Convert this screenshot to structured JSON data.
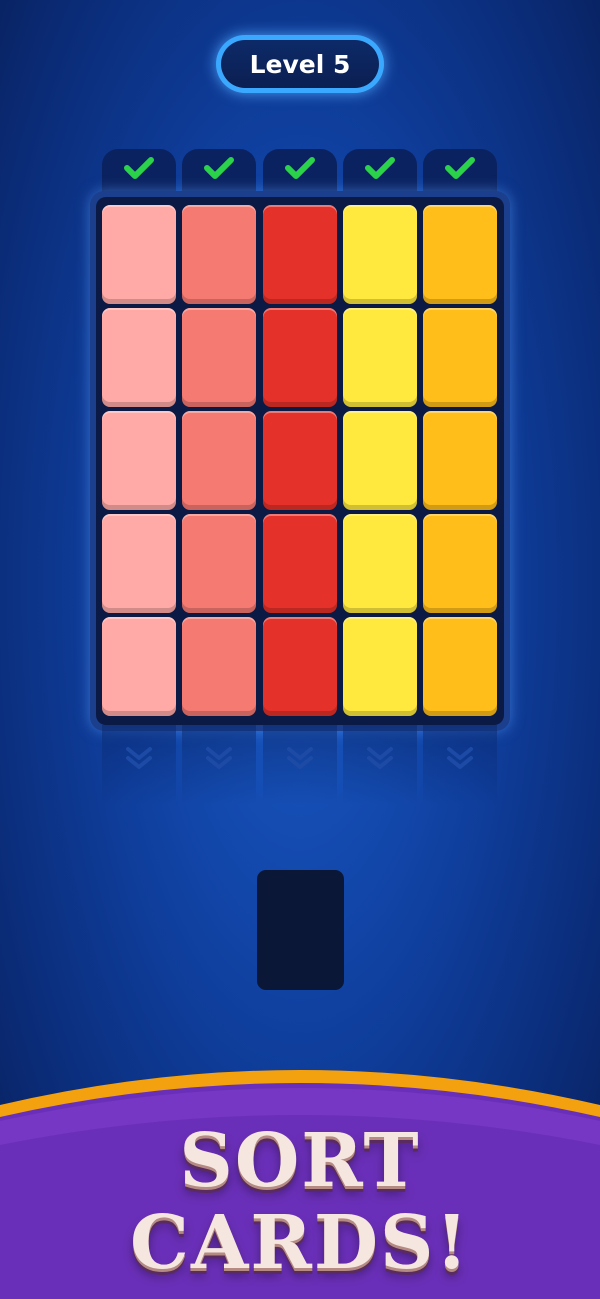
{
  "header": {
    "level_label": "Level 5"
  },
  "tabs": [
    {
      "icon": "check-icon",
      "state": "complete"
    },
    {
      "icon": "check-icon",
      "state": "complete"
    },
    {
      "icon": "check-icon",
      "state": "complete"
    },
    {
      "icon": "check-icon",
      "state": "complete"
    },
    {
      "icon": "check-icon",
      "state": "complete"
    }
  ],
  "board": {
    "columns": [
      {
        "color": "#ffaaa6",
        "cards": 5
      },
      {
        "color": "#f57a72",
        "cards": 5
      },
      {
        "color": "#e4312a",
        "cards": 5
      },
      {
        "color": "#ffe93f",
        "cards": 5
      },
      {
        "color": "#ffbe1a",
        "cards": 5
      }
    ]
  },
  "colors": {
    "check": "#2bd34a",
    "banner_purple": "#6a2fb8",
    "banner_trim": "#f3a10f"
  },
  "banner": {
    "line1": "SORT",
    "line2": "CARDS!"
  }
}
